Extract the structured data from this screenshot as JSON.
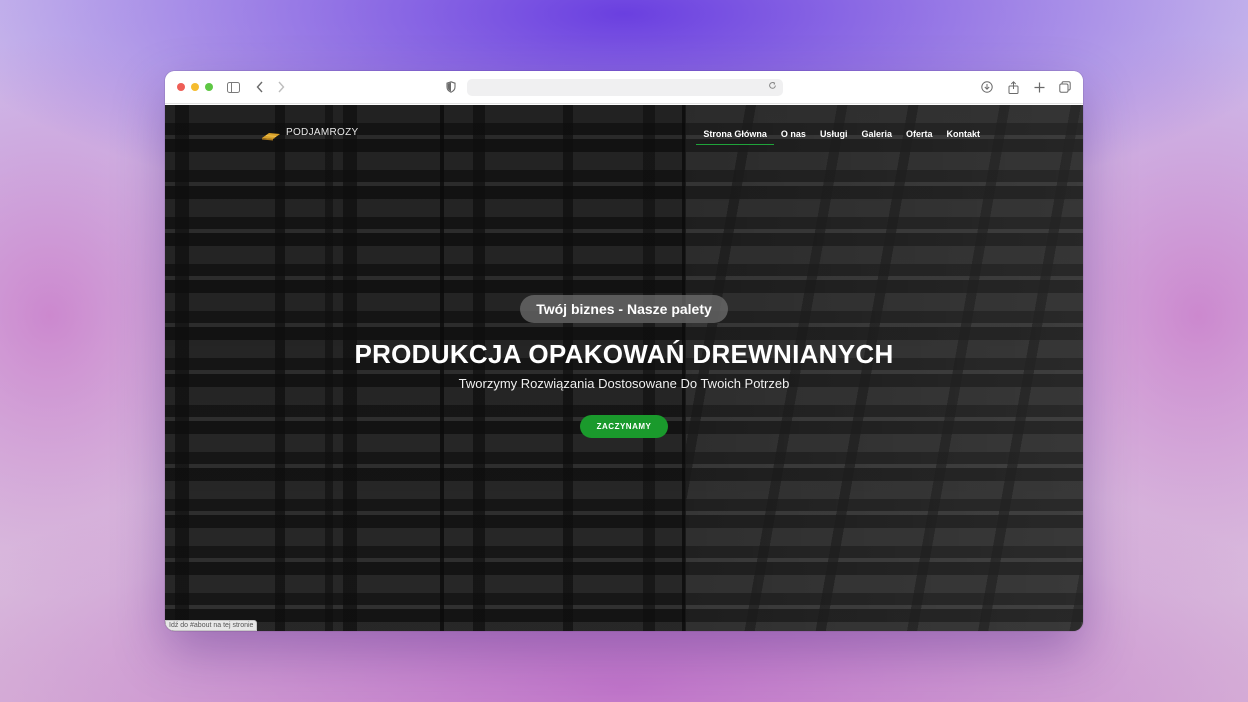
{
  "browser": {
    "url": "",
    "icons": [
      "sidebar-icon",
      "back-icon",
      "forward-icon",
      "shield-icon",
      "reload-icon",
      "download-icon",
      "share-icon",
      "new-tab-icon",
      "tabs-overview-icon"
    ]
  },
  "site": {
    "logo_text": "PODJAMROZY",
    "menu": [
      {
        "label": "Strona Główna",
        "active": true
      },
      {
        "label": "O nas",
        "active": false
      },
      {
        "label": "Usługi",
        "active": false
      },
      {
        "label": "Galeria",
        "active": false
      },
      {
        "label": "Oferta",
        "active": false
      },
      {
        "label": "Kontakt",
        "active": false
      }
    ],
    "accent_color": "#1a9a2c"
  },
  "hero": {
    "pill": "Twój biznes - Nasze palety",
    "headline": "PRODUKCJA OPAKOWAŃ DREWNIANYCH",
    "subheadline": "Tworzymy Rozwiązania Dostosowane Do Twoich Potrzeb",
    "cta_label": "ZACZYNAMY"
  },
  "status_bar": {
    "text": "Idź do #about na tej stronie"
  }
}
